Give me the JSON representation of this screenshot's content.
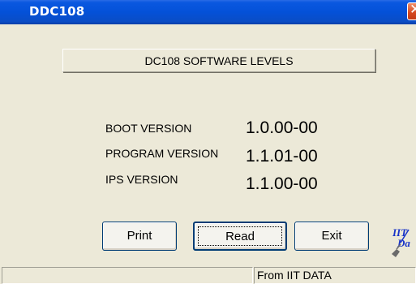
{
  "window": {
    "title": "DDC108",
    "close_glyph": "✕"
  },
  "header": {
    "title": "DC108 SOFTWARE LEVELS"
  },
  "versions": [
    {
      "label": "BOOT VERSION",
      "value": "1.0.00-00"
    },
    {
      "label": "PROGRAM VERSION",
      "value": "1.1.01-00"
    },
    {
      "label": "IPS VERSION",
      "value": "1.1.00-00"
    }
  ],
  "buttons": {
    "print": "Print",
    "read": "Read",
    "exit": "Exit"
  },
  "logo": {
    "text": "IIT Data",
    "icon": "iit-data-logo-icon"
  },
  "status": {
    "left": "",
    "right": "From IIT DATA"
  },
  "colors": {
    "titlebar": "#0451d8",
    "dialog_bg": "#ece9d8",
    "logo_blue": "#1a35c8"
  }
}
